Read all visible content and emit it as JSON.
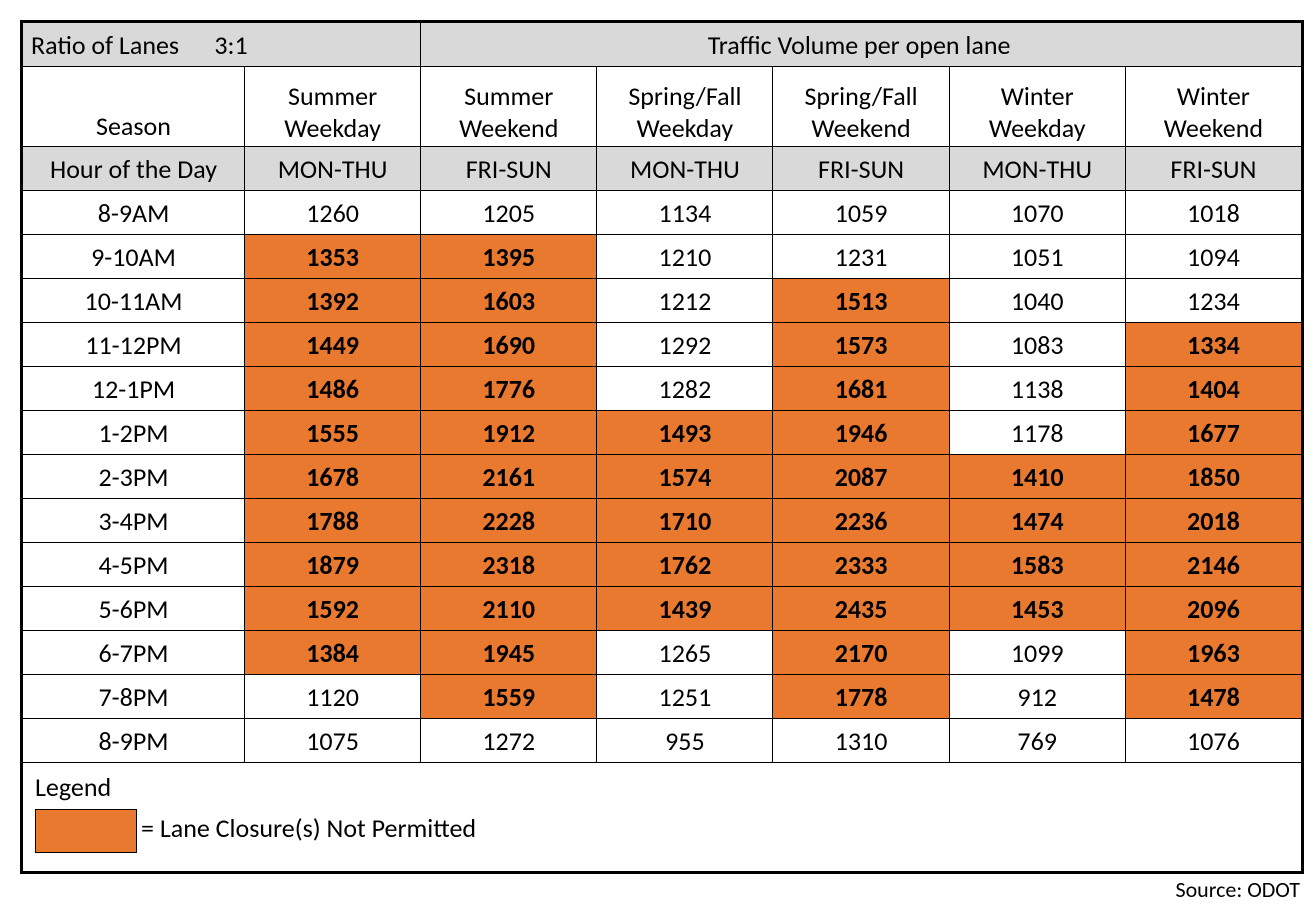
{
  "header": {
    "ratio_label": "Ratio of Lanes",
    "ratio_value": "3:1",
    "traffic_title": "Traffic Volume per open lane",
    "season_label": "Season",
    "hour_label": "Hour of the Day"
  },
  "columns": [
    {
      "season": "Summer\nWeekday",
      "dow": "MON-THU"
    },
    {
      "season": "Summer\nWeekend",
      "dow": "FRI-SUN"
    },
    {
      "season": "Spring/Fall\nWeekday",
      "dow": "MON-THU"
    },
    {
      "season": "Spring/Fall\nWeekend",
      "dow": "FRI-SUN"
    },
    {
      "season": "Winter\nWeekday",
      "dow": "MON-THU"
    },
    {
      "season": "Winter\nWeekend",
      "dow": "FRI-SUN"
    }
  ],
  "rows": [
    {
      "hour": "8-9AM",
      "cells": [
        {
          "v": 1260,
          "np": false
        },
        {
          "v": 1205,
          "np": false
        },
        {
          "v": 1134,
          "np": false
        },
        {
          "v": 1059,
          "np": false
        },
        {
          "v": 1070,
          "np": false
        },
        {
          "v": 1018,
          "np": false
        }
      ]
    },
    {
      "hour": "9-10AM",
      "cells": [
        {
          "v": 1353,
          "np": true
        },
        {
          "v": 1395,
          "np": true
        },
        {
          "v": 1210,
          "np": false
        },
        {
          "v": 1231,
          "np": false
        },
        {
          "v": 1051,
          "np": false
        },
        {
          "v": 1094,
          "np": false
        }
      ]
    },
    {
      "hour": "10-11AM",
      "cells": [
        {
          "v": 1392,
          "np": true
        },
        {
          "v": 1603,
          "np": true
        },
        {
          "v": 1212,
          "np": false
        },
        {
          "v": 1513,
          "np": true
        },
        {
          "v": 1040,
          "np": false
        },
        {
          "v": 1234,
          "np": false
        }
      ]
    },
    {
      "hour": "11-12PM",
      "cells": [
        {
          "v": 1449,
          "np": true
        },
        {
          "v": 1690,
          "np": true
        },
        {
          "v": 1292,
          "np": false
        },
        {
          "v": 1573,
          "np": true
        },
        {
          "v": 1083,
          "np": false
        },
        {
          "v": 1334,
          "np": true
        }
      ]
    },
    {
      "hour": "12-1PM",
      "cells": [
        {
          "v": 1486,
          "np": true
        },
        {
          "v": 1776,
          "np": true
        },
        {
          "v": 1282,
          "np": false
        },
        {
          "v": 1681,
          "np": true
        },
        {
          "v": 1138,
          "np": false
        },
        {
          "v": 1404,
          "np": true
        }
      ]
    },
    {
      "hour": "1-2PM",
      "cells": [
        {
          "v": 1555,
          "np": true
        },
        {
          "v": 1912,
          "np": true
        },
        {
          "v": 1493,
          "np": true
        },
        {
          "v": 1946,
          "np": true
        },
        {
          "v": 1178,
          "np": false
        },
        {
          "v": 1677,
          "np": true
        }
      ]
    },
    {
      "hour": "2-3PM",
      "cells": [
        {
          "v": 1678,
          "np": true
        },
        {
          "v": 2161,
          "np": true
        },
        {
          "v": 1574,
          "np": true
        },
        {
          "v": 2087,
          "np": true
        },
        {
          "v": 1410,
          "np": true
        },
        {
          "v": 1850,
          "np": true
        }
      ]
    },
    {
      "hour": "3-4PM",
      "cells": [
        {
          "v": 1788,
          "np": true
        },
        {
          "v": 2228,
          "np": true
        },
        {
          "v": 1710,
          "np": true
        },
        {
          "v": 2236,
          "np": true
        },
        {
          "v": 1474,
          "np": true
        },
        {
          "v": 2018,
          "np": true
        }
      ]
    },
    {
      "hour": "4-5PM",
      "cells": [
        {
          "v": 1879,
          "np": true
        },
        {
          "v": 2318,
          "np": true
        },
        {
          "v": 1762,
          "np": true
        },
        {
          "v": 2333,
          "np": true
        },
        {
          "v": 1583,
          "np": true
        },
        {
          "v": 2146,
          "np": true
        }
      ]
    },
    {
      "hour": "5-6PM",
      "cells": [
        {
          "v": 1592,
          "np": true
        },
        {
          "v": 2110,
          "np": true
        },
        {
          "v": 1439,
          "np": true
        },
        {
          "v": 2435,
          "np": true
        },
        {
          "v": 1453,
          "np": true
        },
        {
          "v": 2096,
          "np": true
        }
      ]
    },
    {
      "hour": "6-7PM",
      "cells": [
        {
          "v": 1384,
          "np": true
        },
        {
          "v": 1945,
          "np": true
        },
        {
          "v": 1265,
          "np": false
        },
        {
          "v": 2170,
          "np": true
        },
        {
          "v": 1099,
          "np": false
        },
        {
          "v": 1963,
          "np": true
        }
      ]
    },
    {
      "hour": "7-8PM",
      "cells": [
        {
          "v": 1120,
          "np": false
        },
        {
          "v": 1559,
          "np": true
        },
        {
          "v": 1251,
          "np": false
        },
        {
          "v": 1778,
          "np": true
        },
        {
          "v": 912,
          "np": false
        },
        {
          "v": 1478,
          "np": true
        }
      ]
    },
    {
      "hour": "8-9PM",
      "cells": [
        {
          "v": 1075,
          "np": false
        },
        {
          "v": 1272,
          "np": false
        },
        {
          "v": 955,
          "np": false
        },
        {
          "v": 1310,
          "np": false
        },
        {
          "v": 769,
          "np": false
        },
        {
          "v": 1076,
          "np": false
        }
      ]
    }
  ],
  "legend": {
    "title": "Legend",
    "text": "= Lane Closure(s) Not Permitted"
  },
  "source": "Source: ODOT",
  "chart_data": {
    "type": "table",
    "title": "Traffic Volume per open lane — Ratio of Lanes 3:1",
    "categories": [
      "8-9AM",
      "9-10AM",
      "10-11AM",
      "11-12PM",
      "12-1PM",
      "1-2PM",
      "2-3PM",
      "3-4PM",
      "4-5PM",
      "5-6PM",
      "6-7PM",
      "7-8PM",
      "8-9PM"
    ],
    "series": [
      {
        "name": "Summer Weekday (MON-THU)",
        "values": [
          1260,
          1353,
          1392,
          1449,
          1486,
          1555,
          1678,
          1788,
          1879,
          1592,
          1384,
          1120,
          1075
        ]
      },
      {
        "name": "Summer Weekend (FRI-SUN)",
        "values": [
          1205,
          1395,
          1603,
          1690,
          1776,
          1912,
          2161,
          2228,
          2318,
          2110,
          1945,
          1559,
          1272
        ]
      },
      {
        "name": "Spring/Fall Weekday (MON-THU)",
        "values": [
          1134,
          1210,
          1212,
          1292,
          1282,
          1493,
          1574,
          1710,
          1762,
          1439,
          1265,
          1251,
          955
        ]
      },
      {
        "name": "Spring/Fall Weekend (FRI-SUN)",
        "values": [
          1059,
          1231,
          1513,
          1573,
          1681,
          1946,
          2087,
          2236,
          2333,
          2435,
          2170,
          1778,
          1310
        ]
      },
      {
        "name": "Winter Weekday (MON-THU)",
        "values": [
          1070,
          1051,
          1040,
          1083,
          1138,
          1178,
          1410,
          1474,
          1583,
          1453,
          1099,
          912,
          769
        ]
      },
      {
        "name": "Winter Weekend (FRI-SUN)",
        "values": [
          1018,
          1094,
          1234,
          1334,
          1404,
          1677,
          1850,
          2018,
          2146,
          2096,
          1963,
          1478,
          1076
        ]
      }
    ],
    "highlight": "Orange cells indicate Lane Closure(s) Not Permitted"
  }
}
